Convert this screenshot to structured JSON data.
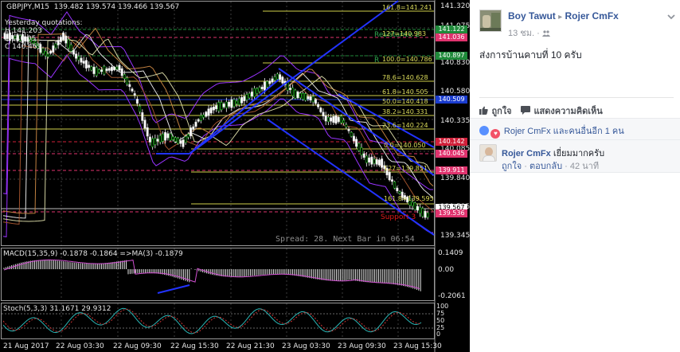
{
  "chart_header": {
    "symbol": "GBPJPY,M15",
    "ohlc": "139.482 139.574 139.466 139.567",
    "yesterday_title": "Yesterday quotations:",
    "high": "H 141.203",
    "low": "L 140.05",
    "close": "C 140.469",
    "spread_text": "Spread: 28. Next Bar in 06:54",
    "resistance_label": "Resistance 2",
    "resistance_label_2": "R",
    "support_label": "Support 3"
  },
  "fib_labels": [
    "161.8=141.241",
    "127=140.983",
    "100.0=140.786",
    "78.6=140.628",
    "61.8=140.505",
    "50.0=140.418",
    "38.2=140.331",
    "23.6=140.224",
    "0.0=140.050",
    "127=139.851",
    "161.8=139.595"
  ],
  "price_axis": {
    "ticks": [
      "141.320",
      "141.075",
      "140.830",
      "140.580",
      "140.335",
      "140.085",
      "139.840",
      "139.595",
      "139.345"
    ],
    "tags": [
      {
        "text": "141.122",
        "color": "#1f8a3a"
      },
      {
        "text": "141.036",
        "color": "#e0336e"
      },
      {
        "text": "140.897",
        "color": "#1f8a3a"
      },
      {
        "text": "140.509",
        "color": "#1a3ccf"
      },
      {
        "text": "140.142",
        "color": "#d0203a"
      },
      {
        "text": "140.045",
        "color": "#e0336e"
      },
      {
        "text": "139.911",
        "color": "#e0336e"
      },
      {
        "text": "139.567",
        "color": "#ffffff"
      },
      {
        "text": "139.536",
        "color": "#e0336e"
      }
    ]
  },
  "macd": {
    "label": "MACD(15,35,9) -0.1878 -0.1864  =>MA(3) -0.1879",
    "ticks": [
      "0.1409",
      "0.00",
      "-0.2061"
    ]
  },
  "stoch": {
    "label": "Stoch(5,3,3) 31.1671 29.9312",
    "ticks": [
      "100",
      "75",
      "50",
      "25",
      "0"
    ]
  },
  "time_axis": [
    "21 Aug 2017",
    "22 Aug 03:30",
    "22 Aug 09:30",
    "22 Aug 15:30",
    "22 Aug 21:30",
    "23 Aug 03:30",
    "23 Aug 09:30",
    "23 Aug 15:30"
  ],
  "post": {
    "author": "Boy Tawut",
    "arrow": "▸",
    "target": "Rojer CmFx",
    "time": "13 ชม.",
    "privacy_icon": "group-icon",
    "text": "ส่งการบ้านคาบที่ 10 ครับ",
    "like": "ถูกใจ",
    "comment": "แสดงความคิดเห็น",
    "reactions": "Rojer CmFx และคนอื่นอีก 1 คน"
  },
  "comment": {
    "author": "Rojer CmFx",
    "text": "เยี่ยมมากครับ",
    "like": "ถูกใจ",
    "reply": "ตอบกลับ",
    "dot": "·",
    "time": "42 นาที"
  }
}
